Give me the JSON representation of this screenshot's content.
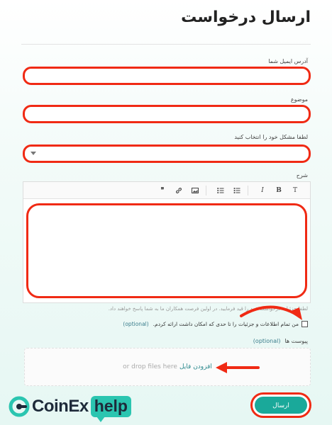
{
  "page": {
    "title": "ارسال درخواست"
  },
  "form": {
    "email_label": "آدرس ایمیل شما",
    "subject_label": "موضوع",
    "issue_label": "لطفا مشکل خود را انتخاب کنید",
    "description_label": "شرح",
    "description_hint": "لطفا جزئیات درخواست خود را قید فرمایید. در اولین فرصت همکاران ما به شما پاسخ خواهند داد.",
    "consent_text": "من تمام اطلاعات و جزئیات را تا حدی که امکان داشت ارائه کردم.",
    "optional": "(optional)",
    "attachments_label": "پیوست ها",
    "add_file_link": "افزودن فایل",
    "drop_text": "or drop files here",
    "submit_label": "ارسال"
  },
  "toolbar": {
    "icons": [
      "text-style-icon",
      "bold-icon",
      "italic-icon",
      "bullet-list-icon",
      "numbered-list-icon",
      "image-icon",
      "link-icon",
      "quote-icon"
    ],
    "text_style": "T",
    "bold": "B",
    "italic": "I",
    "quote": "❞"
  },
  "brand": {
    "name": "CoinEx",
    "suffix": "help",
    "accent": "#2bc5b0",
    "highlight": "#f02a14",
    "button": "#1aa99a"
  }
}
